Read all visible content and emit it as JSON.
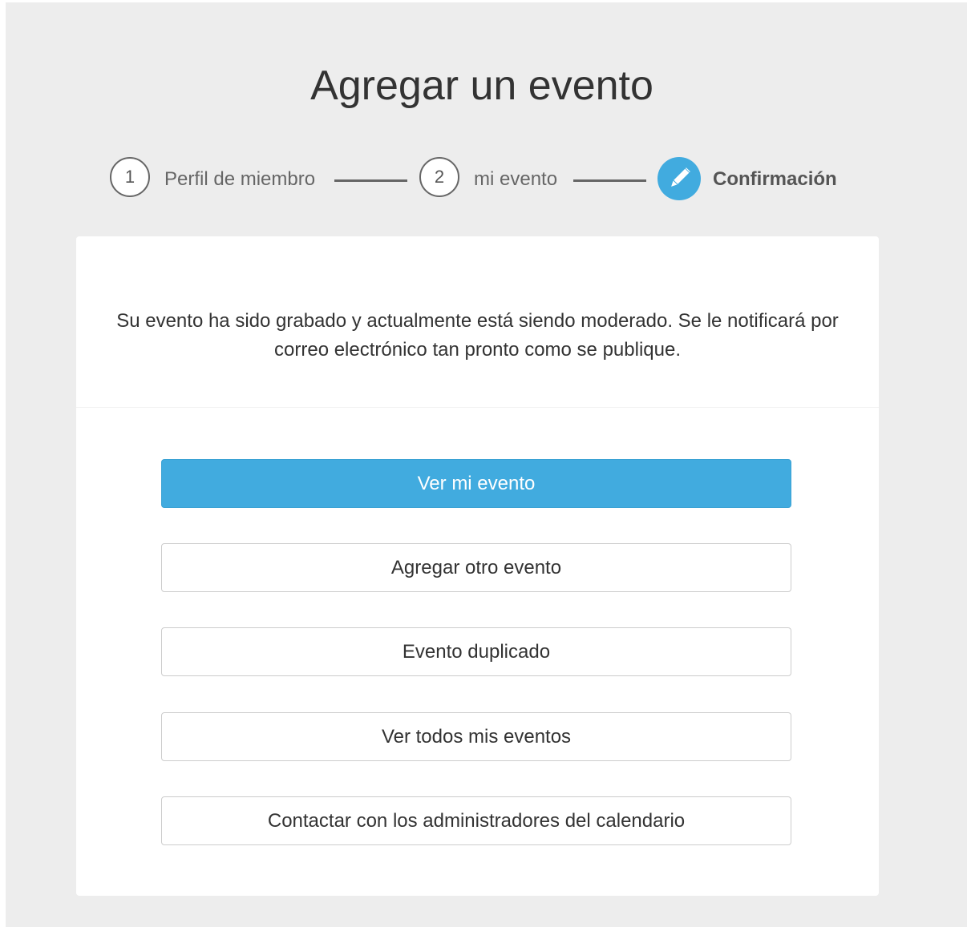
{
  "header": {
    "title": "Agregar un evento"
  },
  "steps": [
    {
      "number": "1",
      "label": "Perfil de miembro"
    },
    {
      "number": "2",
      "label": "mi evento"
    },
    {
      "icon": "pencil-icon",
      "label": "Confirmación",
      "active": true
    }
  ],
  "colors": {
    "accent": "#41abdf",
    "background": "#ededed"
  },
  "card": {
    "message": "Su evento ha sido grabado y actualmente está siendo moderado. Se le notificará por correo electrónico tan pronto como se publique."
  },
  "actions": {
    "view_event": "Ver mi evento",
    "add_another": "Agregar otro evento",
    "duplicate": "Evento duplicado",
    "view_all": "Ver todos mis eventos",
    "contact_admins": "Contactar con los administradores del calendario"
  }
}
